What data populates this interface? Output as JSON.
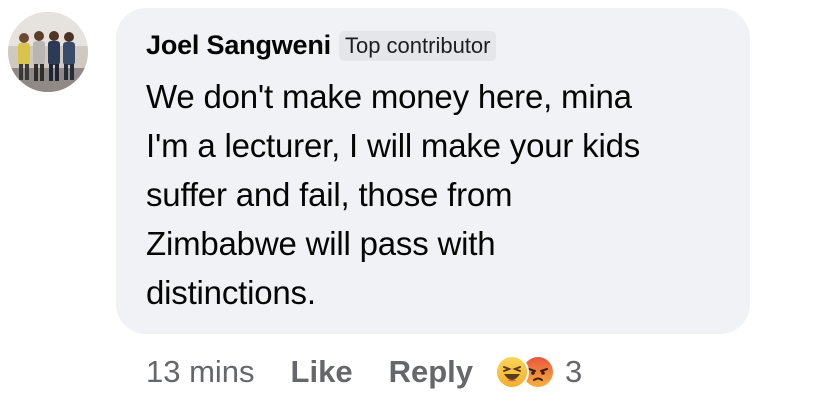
{
  "comment": {
    "author": "Joel Sangweni",
    "badge": "Top contributor",
    "text": "We don't make money here, mina\nI'm  a lecturer, I will make your kids\nsuffer and fail, those from\nZimbabwe will pass with\ndistinctions.",
    "avatar_icon": "profile-photo"
  },
  "actions": {
    "time": "13 mins",
    "like_label": "Like",
    "reply_label": "Reply"
  },
  "reactions": {
    "icons": [
      "haha-reaction-icon",
      "angry-reaction-icon"
    ],
    "count": "3",
    "colors": {
      "haha": "#f7c33f",
      "angry_top": "#e9573e",
      "angry_bottom": "#f6b13f"
    }
  },
  "colors": {
    "bubble_bg": "#f0f2f5",
    "name_text": "#050505",
    "secondary_text": "#65676b",
    "badge_bg": "#e4e6ea"
  }
}
